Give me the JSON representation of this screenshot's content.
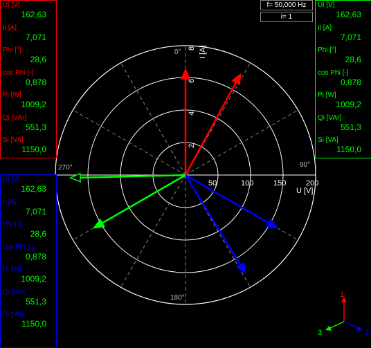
{
  "panels": {
    "red": {
      "color": "#ff0000",
      "rows": [
        {
          "label": "Ui [V]",
          "value": "162,63"
        },
        {
          "label": "Ii [A]",
          "value": "7,071"
        },
        {
          "label": "Phi [°]",
          "value": "28,6"
        },
        {
          "label": "cos Phi [-]",
          "value": "0,878"
        },
        {
          "label": "Pi [W]",
          "value": "1009,2"
        },
        {
          "label": "Qi [VAr]",
          "value": "551,3"
        },
        {
          "label": "Si [VA]",
          "value": "1150,0"
        }
      ]
    },
    "green": {
      "color": "#00ff00",
      "rows": [
        {
          "label": "Ui [V]",
          "value": "162,63"
        },
        {
          "label": "Ii [A]",
          "value": "7,071"
        },
        {
          "label": "Phi [°]",
          "value": "28,6"
        },
        {
          "label": "cos Phi [-]",
          "value": "0,878"
        },
        {
          "label": "Pi [W]",
          "value": "1009,2"
        },
        {
          "label": "Qi [VAr]",
          "value": "551,3"
        },
        {
          "label": "Si [VA]",
          "value": "1150,0"
        }
      ]
    },
    "blue": {
      "color": "#0000ff",
      "rows": [
        {
          "label": "Ui [V]",
          "value": "162,63"
        },
        {
          "label": "Ii [A]",
          "value": "7,071"
        },
        {
          "label": "Phi [°]",
          "value": "28,6"
        },
        {
          "label": "cos Phi [-]",
          "value": "0,878"
        },
        {
          "label": "Pi [W]",
          "value": "1009,2"
        },
        {
          "label": "Qi [VAr]",
          "value": "551,3"
        },
        {
          "label": "Si [VA]",
          "value": "1150,0"
        }
      ]
    }
  },
  "info": {
    "frequency": "f= 50,000 Hz",
    "index": "i= 1"
  },
  "polar": {
    "angle_labels": {
      "top": "0°",
      "right": "90°",
      "bottom": "180°",
      "left": "270°"
    },
    "voltage_axis": {
      "label": "U [V]",
      "ticks": [
        "50",
        "100",
        "150",
        "200"
      ],
      "max": 200
    },
    "current_axis": {
      "label": "I [A]",
      "ticks": [
        "2",
        "4",
        "6",
        "8"
      ],
      "max": 8
    }
  },
  "phasors": [
    {
      "phase": "1",
      "color": "#ff0000",
      "voltage_angle": 0,
      "voltage": 162.63,
      "current_angle": 28.6,
      "current": 7.071
    },
    {
      "phase": "2",
      "color": "#0000ff",
      "voltage_angle": 120,
      "voltage": 162.63,
      "current_angle": 148.6,
      "current": 7.071
    },
    {
      "phase": "3",
      "color": "#00ff00",
      "voltage_angle": 240,
      "voltage": 162.63,
      "current_angle": 268.6,
      "current": 7.071
    }
  ],
  "axis_triad": {
    "labels": [
      "1",
      "2",
      "3"
    ],
    "colors": [
      "#ff0000",
      "#0000ff",
      "#00ff00"
    ]
  }
}
